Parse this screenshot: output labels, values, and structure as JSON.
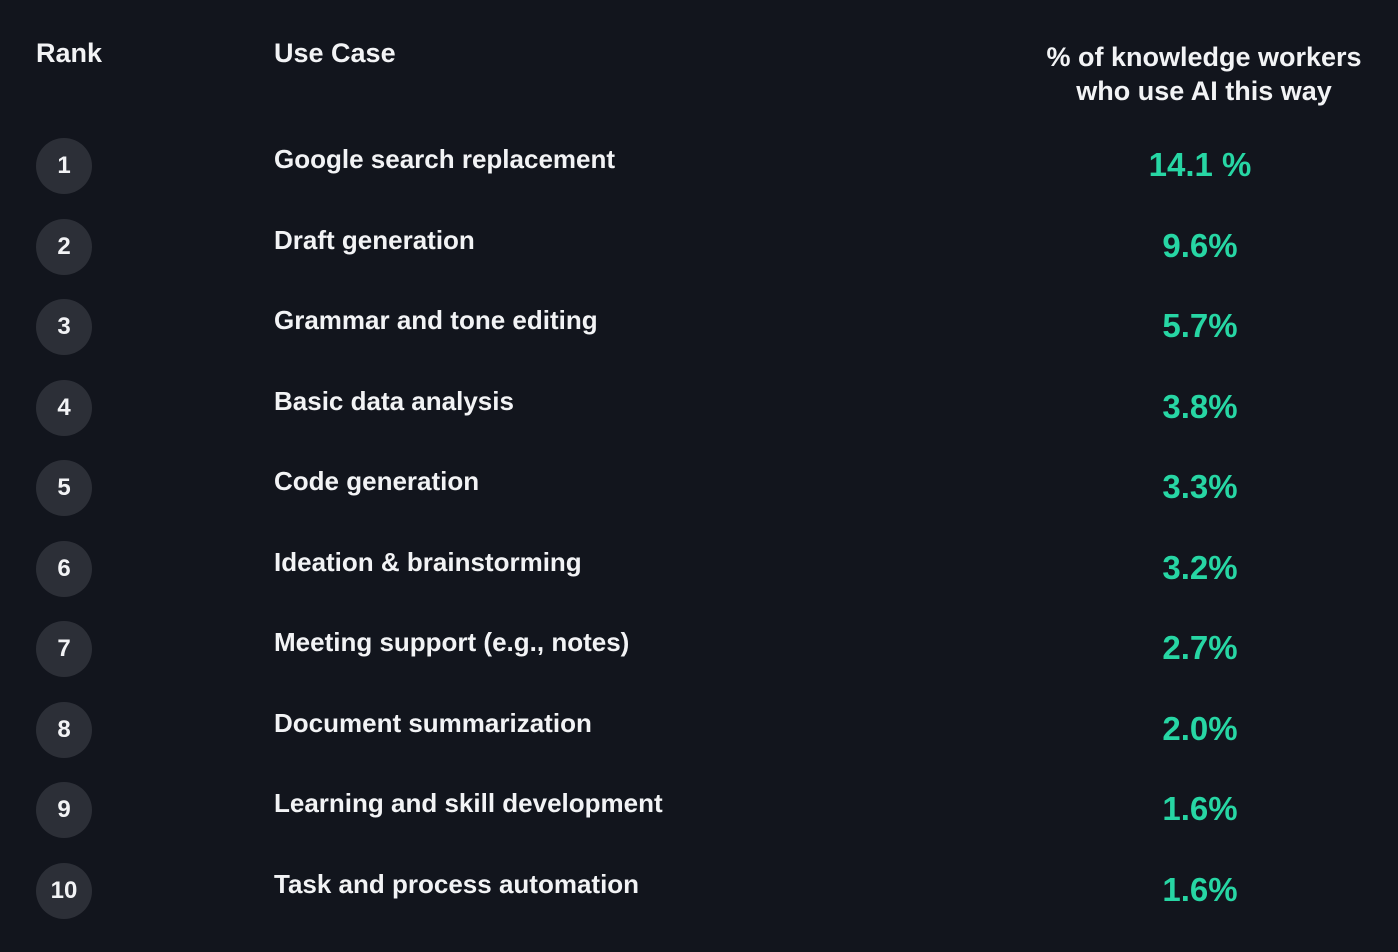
{
  "header": {
    "rank": "Rank",
    "use_case": "Use Case",
    "pct_line1": "% of knowledge workers",
    "pct_line2": "who use AI this way"
  },
  "colors": {
    "background": "#12151d",
    "text": "#f2f3f5",
    "accent": "#27d6a4",
    "badge": "#2c2f37"
  },
  "rows": [
    {
      "rank": "1",
      "use_case": "Google search replacement",
      "pct": "14.1 %"
    },
    {
      "rank": "2",
      "use_case": "Draft generation",
      "pct": "9.6%"
    },
    {
      "rank": "3",
      "use_case": "Grammar and tone editing",
      "pct": "5.7%"
    },
    {
      "rank": "4",
      "use_case": "Basic data analysis",
      "pct": "3.8%"
    },
    {
      "rank": "5",
      "use_case": "Code generation",
      "pct": "3.3%"
    },
    {
      "rank": "6",
      "use_case": "Ideation & brainstorming",
      "pct": "3.2%"
    },
    {
      "rank": "7",
      "use_case": "Meeting support (e.g., notes)",
      "pct": "2.7%"
    },
    {
      "rank": "8",
      "use_case": "Document summarization",
      "pct": "2.0%"
    },
    {
      "rank": "9",
      "use_case": "Learning and skill development",
      "pct": "1.6%"
    },
    {
      "rank": "10",
      "use_case": "Task and process automation",
      "pct": "1.6%"
    }
  ]
}
